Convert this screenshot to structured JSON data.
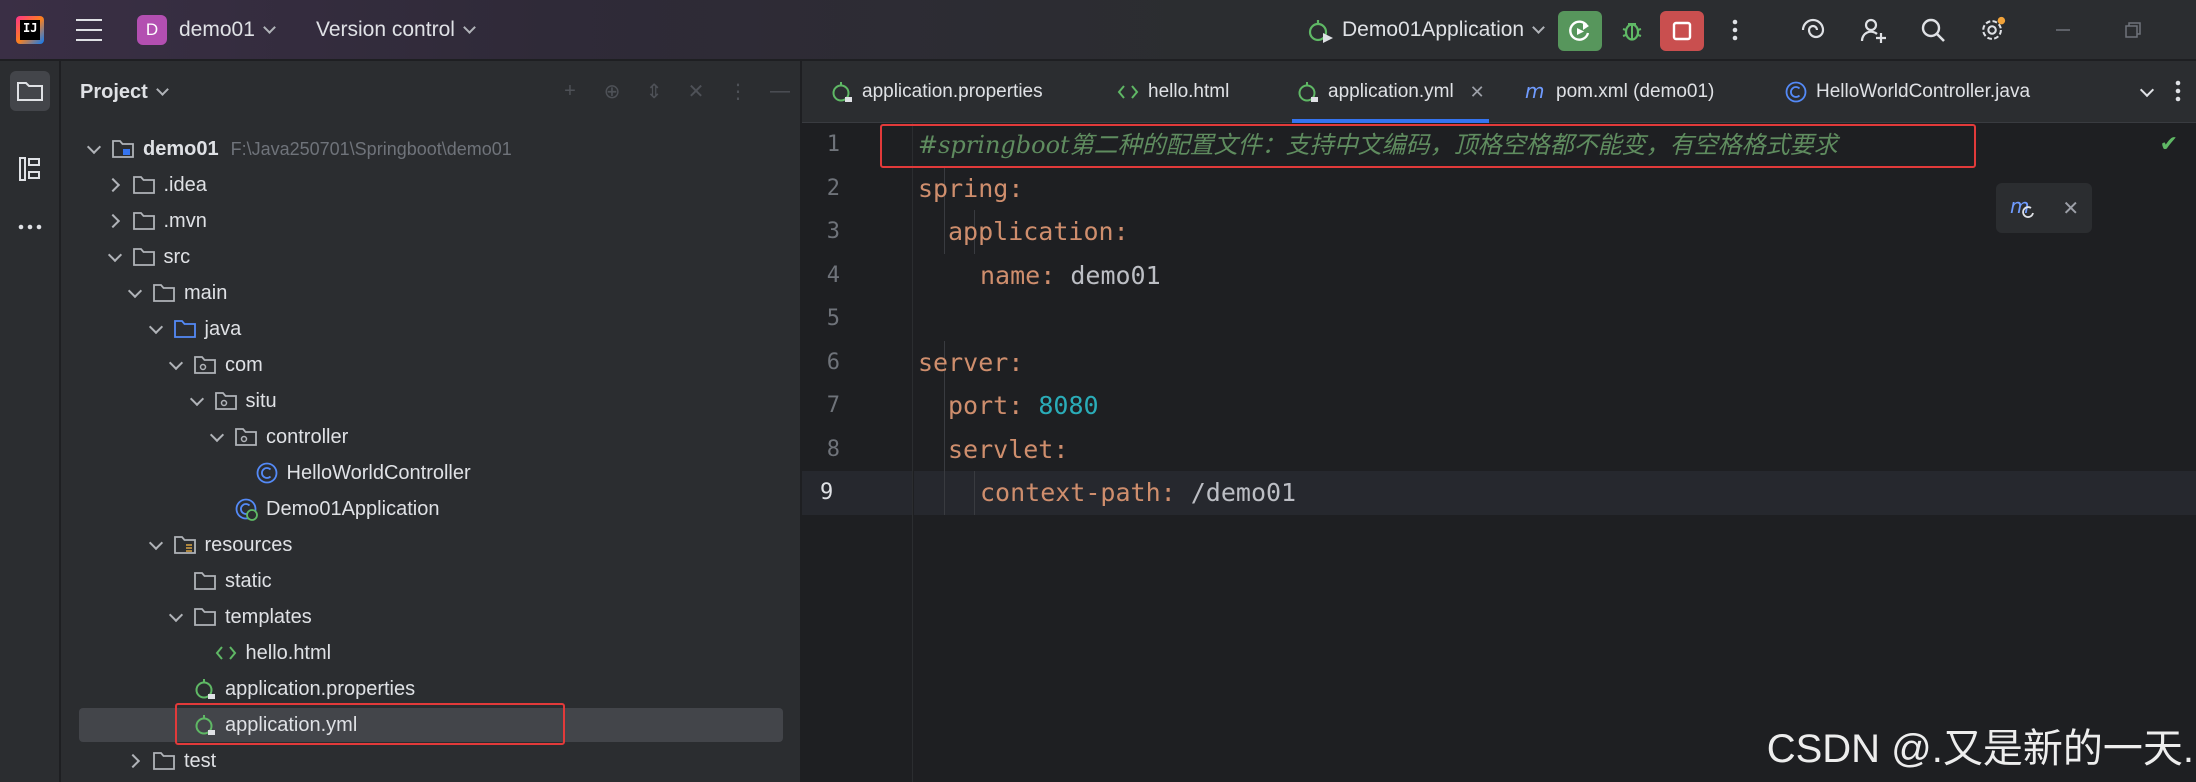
{
  "titlebar": {
    "project_badge": "D",
    "project_name": "demo01",
    "vcs_label": "Version control",
    "run_config": "Demo01Application"
  },
  "project_panel": {
    "title": "Project",
    "tree": [
      {
        "label": "demo01",
        "path": "F:\\Java250701\\Springboot\\demo01",
        "level": 0,
        "arrow": "down",
        "icon": "module-folder-icon",
        "bold": true
      },
      {
        "label": ".idea",
        "level": 1,
        "arrow": "right",
        "icon": "folder-icon"
      },
      {
        "label": ".mvn",
        "level": 1,
        "arrow": "right",
        "icon": "folder-icon"
      },
      {
        "label": "src",
        "level": 1,
        "arrow": "down",
        "icon": "folder-icon"
      },
      {
        "label": "main",
        "level": 2,
        "arrow": "down",
        "icon": "folder-icon"
      },
      {
        "label": "java",
        "level": 3,
        "arrow": "down",
        "icon": "source-folder-icon"
      },
      {
        "label": "com",
        "level": 4,
        "arrow": "down",
        "icon": "package-icon"
      },
      {
        "label": "situ",
        "level": 5,
        "arrow": "down",
        "icon": "package-icon"
      },
      {
        "label": "controller",
        "level": 6,
        "arrow": "down",
        "icon": "package-icon"
      },
      {
        "label": "HelloWorldController",
        "level": 7,
        "arrow": "none",
        "icon": "class-icon"
      },
      {
        "label": "Demo01Application",
        "level": 6,
        "arrow": "none",
        "icon": "spring-boot-class-icon"
      },
      {
        "label": "resources",
        "level": 3,
        "arrow": "down",
        "icon": "resources-folder-icon"
      },
      {
        "label": "static",
        "level": 4,
        "arrow": "none",
        "icon": "folder-icon"
      },
      {
        "label": "templates",
        "level": 4,
        "arrow": "down",
        "icon": "folder-icon"
      },
      {
        "label": "hello.html",
        "level": 5,
        "arrow": "none",
        "icon": "html-icon"
      },
      {
        "label": "application.properties",
        "level": 4,
        "arrow": "none",
        "icon": "spring-config-icon"
      },
      {
        "label": "application.yml",
        "level": 4,
        "arrow": "none",
        "icon": "spring-config-icon",
        "selected": true
      },
      {
        "label": "test",
        "level": 2,
        "arrow": "right",
        "icon": "folder-icon"
      }
    ]
  },
  "tabs": [
    {
      "label": "application.properties",
      "icon": "spring-config-icon"
    },
    {
      "label": "hello.html",
      "icon": "html-icon"
    },
    {
      "label": "application.yml",
      "icon": "spring-config-icon",
      "active": true
    },
    {
      "label": "pom.xml (demo01)",
      "icon": "maven-icon"
    },
    {
      "label": "HelloWorldController.java",
      "icon": "class-icon"
    }
  ],
  "editor": {
    "line_numbers": [
      "1",
      "2",
      "3",
      "4",
      "5",
      "6",
      "7",
      "8",
      "9"
    ],
    "lines": {
      "l1": "#springboot第二种的配置文件：支持中文编码，顶格空格都不能变，有空格格式要求",
      "l2_key": "spring",
      "l3_key": "application",
      "l4_key": "name",
      "l4_val": "demo01",
      "l6_key": "server",
      "l7_key": "port",
      "l7_val": "8080",
      "l8_key": "servlet",
      "l9_key": "context-path",
      "l9_val": "/demo01"
    },
    "colon": ":",
    "current_line": 9
  },
  "watermark": "CSDN @.又是新的一天."
}
